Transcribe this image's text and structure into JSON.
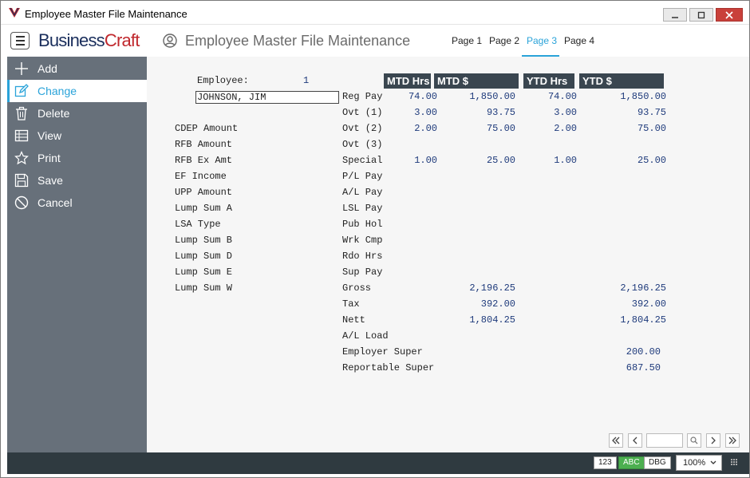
{
  "window": {
    "title": "Employee Master File Maintenance"
  },
  "header": {
    "brand_part1": "Business",
    "brand_part2": "Craft",
    "screen_title": "Employee Master File Maintenance",
    "tabs": [
      {
        "label": "Page 1",
        "active": false
      },
      {
        "label": "Page 2",
        "active": false
      },
      {
        "label": "Page 3",
        "active": true
      },
      {
        "label": "Page 4",
        "active": false
      }
    ]
  },
  "sidebar": {
    "items": [
      {
        "label": "Add",
        "icon": "plus-icon"
      },
      {
        "label": "Change",
        "icon": "edit-icon",
        "selected": true
      },
      {
        "label": "Delete",
        "icon": "trash-icon"
      },
      {
        "label": "View",
        "icon": "table-icon"
      },
      {
        "label": "Print",
        "icon": "star-icon"
      },
      {
        "label": "Save",
        "icon": "save-icon"
      },
      {
        "label": "Cancel",
        "icon": "cancel-icon"
      }
    ]
  },
  "form": {
    "employee_label": "Employee:",
    "employee_number": "1",
    "employee_name": "JOHNSON, JIM",
    "left_labels": [
      "CDEP Amount",
      "RFB Amount",
      "RFB Ex Amt",
      "EF Income",
      "UPP Amount",
      "Lump Sum A",
      "LSA Type",
      "Lump Sum B",
      "Lump Sum D",
      "Lump Sum E",
      "Lump Sum W"
    ],
    "column_headers": [
      "MTD Hrs",
      "MTD $",
      "YTD Hrs",
      "YTD $"
    ],
    "rows": [
      {
        "label": "Reg Pay",
        "mtd_hrs": "74.00",
        "mtd_amt": "1,850.00",
        "ytd_hrs": "74.00",
        "ytd_amt": "1,850.00"
      },
      {
        "label": "Ovt (1)",
        "mtd_hrs": "3.00",
        "mtd_amt": "93.75",
        "ytd_hrs": "3.00",
        "ytd_amt": "93.75"
      },
      {
        "label": "Ovt (2)",
        "mtd_hrs": "2.00",
        "mtd_amt": "75.00",
        "ytd_hrs": "2.00",
        "ytd_amt": "75.00"
      },
      {
        "label": "Ovt (3)",
        "mtd_hrs": "",
        "mtd_amt": "",
        "ytd_hrs": "",
        "ytd_amt": ""
      },
      {
        "label": "Special",
        "mtd_hrs": "1.00",
        "mtd_amt": "25.00",
        "ytd_hrs": "1.00",
        "ytd_amt": "25.00"
      },
      {
        "label": "P/L Pay",
        "mtd_hrs": "",
        "mtd_amt": "",
        "ytd_hrs": "",
        "ytd_amt": ""
      },
      {
        "label": "A/L Pay",
        "mtd_hrs": "",
        "mtd_amt": "",
        "ytd_hrs": "",
        "ytd_amt": ""
      },
      {
        "label": "LSL Pay",
        "mtd_hrs": "",
        "mtd_amt": "",
        "ytd_hrs": "",
        "ytd_amt": ""
      },
      {
        "label": "Pub Hol",
        "mtd_hrs": "",
        "mtd_amt": "",
        "ytd_hrs": "",
        "ytd_amt": ""
      },
      {
        "label": "Wrk Cmp",
        "mtd_hrs": "",
        "mtd_amt": "",
        "ytd_hrs": "",
        "ytd_amt": ""
      },
      {
        "label": "Rdo Hrs",
        "mtd_hrs": "",
        "mtd_amt": "",
        "ytd_hrs": "",
        "ytd_amt": ""
      },
      {
        "label": "Sup Pay",
        "mtd_hrs": "",
        "mtd_amt": "",
        "ytd_hrs": "",
        "ytd_amt": ""
      },
      {
        "label": "Gross",
        "mtd_hrs": "",
        "mtd_amt": "2,196.25",
        "ytd_hrs": "",
        "ytd_amt": "2,196.25"
      },
      {
        "label": "Tax",
        "mtd_hrs": "",
        "mtd_amt": "392.00",
        "ytd_hrs": "",
        "ytd_amt": "392.00"
      },
      {
        "label": "Nett",
        "mtd_hrs": "",
        "mtd_amt": "1,804.25",
        "ytd_hrs": "",
        "ytd_amt": "1,804.25"
      },
      {
        "label": "A/L Load",
        "mtd_hrs": "",
        "mtd_amt": "",
        "ytd_hrs": "",
        "ytd_amt": ""
      },
      {
        "label": "Employer Super",
        "mtd_hrs": "",
        "mtd_amt": "",
        "ytd_hrs": "",
        "ytd_amt": "200.00"
      },
      {
        "label": "Reportable Super",
        "mtd_hrs": "",
        "mtd_amt": "",
        "ytd_hrs": "",
        "ytd_amt": "687.50"
      }
    ]
  },
  "statusbar": {
    "badge_num": "123",
    "badge_abc": "ABC",
    "badge_dbg": "DBG",
    "zoom": "100%"
  },
  "colors": {
    "accent": "#2aa3d9",
    "sidebar": "#67707a",
    "header_cell": "#3a4650",
    "value_text": "#1e3a7b",
    "brand_dark": "#1a2e5c",
    "brand_red": "#c0282d"
  }
}
